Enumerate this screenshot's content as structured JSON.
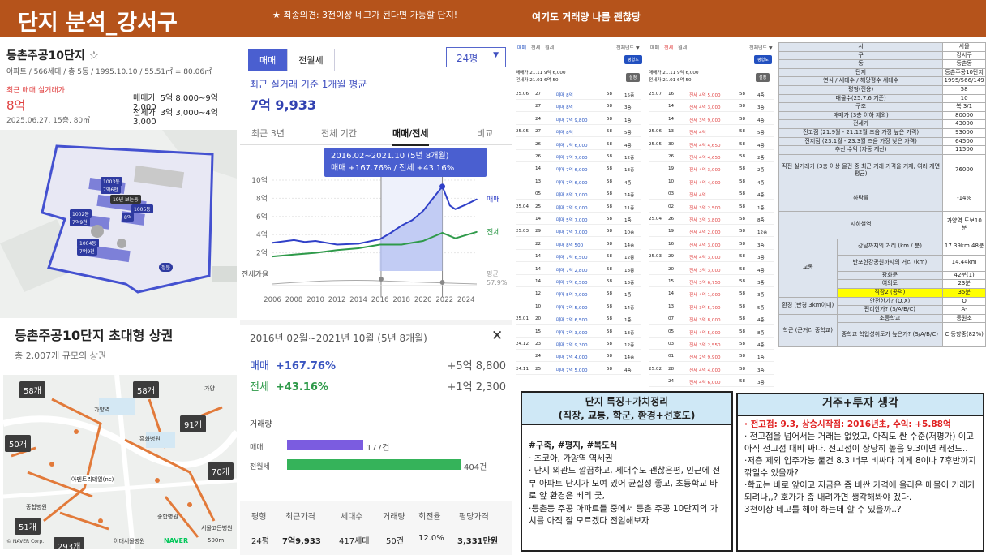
{
  "banner": {
    "title": "단지 분석_강서구",
    "opinion": "★ 최종의견: 3천이상 네고가 된다면 가능할 단지!",
    "note": "여기도 거래량 나름 괜찮당"
  },
  "listing": {
    "name": "등촌주공10단지 ☆",
    "meta": "아파트 / 566세대 / 총 5동 / 1995.10.10 / 55.51㎡ = 80.06㎡",
    "recent_label": "최근 매매 실거래가",
    "recent_price": "8억",
    "recent_date": "2025.06.27, 15층, 80㎡",
    "sale_label": "매매가",
    "sale_range": "5억 8,000~9억 2,000",
    "jeonse_label": "전세가",
    "jeonse_range": "3억 3,000~4억 3,000"
  },
  "map1": {
    "buildings": [
      "1003동",
      "1002동",
      "1001동",
      "1005동",
      "1006동",
      "1004동"
    ],
    "prices": [
      "7억6천",
      "7억9천",
      "8억",
      "7억9천"
    ],
    "other_label": "19년 보는동",
    "exit_label": "정문"
  },
  "commercial": {
    "title": "등촌주공10단지 초대형 상권",
    "subtitle": "총 2,007개 규모의 상권",
    "counts": [
      "58개",
      "58개",
      "91개",
      "50개",
      "70개",
      "51개",
      "293개"
    ],
    "places": [
      "아펜트리테일(nc)",
      "종합병원",
      "종합병원",
      "흥화병원",
      "서울고든병원",
      "가양역",
      "가양",
      "이대서울병원",
      "500m"
    ],
    "naver": "NAVER",
    "credit": "© NAVER Corp."
  },
  "price": {
    "tabs": [
      "매매",
      "전월세"
    ],
    "size": "24평",
    "avg_label": "최근 실거래 기준 1개월 평균",
    "avg_value": "7억 9,933",
    "period_tabs": [
      "최근 3년",
      "전체 기간",
      "매매/전세",
      "비교"
    ],
    "tooltip_title": "2016.02~2021.10 (5년 8개월)",
    "tooltip_body": "매매 +167.76%  /  전세 +43.16%",
    "legend_sale": "매매",
    "legend_jeonse": "전세",
    "legend_ratio1": "평균",
    "legend_ratio2": "57.9%",
    "ratio_label": "전세가율",
    "y_ticks": [
      "10억",
      "8억",
      "6억",
      "4억",
      "2억"
    ],
    "x_ticks": [
      "2006",
      "2008",
      "2010",
      "2012",
      "2014",
      "2016",
      "2018",
      "2020",
      "2022",
      "2024"
    ],
    "period": "2016년 02월~2021년 10월 (5년 8개월)",
    "close": "✕",
    "sale_label": "매매",
    "sale_pct": "+167.76%",
    "sale_amt": "+5억 8,800",
    "jeonse_label": "전세",
    "jeonse_pct": "+43.16%",
    "jeonse_amt": "+1억 2,300",
    "vol_title": "거래량",
    "vol_sale_label": "매매",
    "vol_sale": "177건",
    "vol_rent_label": "전월세",
    "vol_rent": "404건",
    "table_headers": [
      "평형",
      "최근가격",
      "세대수",
      "거래량",
      "회전율",
      "평당가격"
    ],
    "table_row": [
      "24평",
      "7억9,933",
      "417세대",
      "50건",
      "12.0%",
      "3,331만원"
    ]
  },
  "chart_data": {
    "type": "line",
    "x_range": [
      2006,
      2025
    ],
    "y_range_eok": [
      0,
      10
    ],
    "series": [
      {
        "name": "매매",
        "points": [
          [
            2006,
            3.1
          ],
          [
            2008,
            3.4
          ],
          [
            2009,
            3.2
          ],
          [
            2010,
            3.3
          ],
          [
            2012,
            2.9
          ],
          [
            2014,
            3.0
          ],
          [
            2016,
            3.5
          ],
          [
            2017,
            4.2
          ],
          [
            2018,
            5.0
          ],
          [
            2019,
            5.6
          ],
          [
            2020,
            6.6
          ],
          [
            2021,
            8.1
          ],
          [
            2021.8,
            9.3
          ],
          [
            2022.5,
            7.2
          ],
          [
            2023,
            6.8
          ],
          [
            2024,
            7.3
          ],
          [
            2025,
            7.9
          ]
        ]
      },
      {
        "name": "전세",
        "points": [
          [
            2006,
            1.6
          ],
          [
            2008,
            1.8
          ],
          [
            2010,
            2.0
          ],
          [
            2012,
            2.3
          ],
          [
            2014,
            2.5
          ],
          [
            2016,
            2.9
          ],
          [
            2018,
            2.9
          ],
          [
            2020,
            3.3
          ],
          [
            2021.8,
            4.2
          ],
          [
            2023,
            3.6
          ],
          [
            2025,
            4.3
          ]
        ]
      }
    ],
    "ratio_avg": "57.9%"
  },
  "trades": {
    "tabsA": [
      "매매",
      "전세",
      "월세"
    ],
    "tabsB": [
      "매매",
      "전세",
      "월세"
    ],
    "sel": "전체년도 ▼",
    "btn": "평형도",
    "btn2": "설정",
    "infoA": [
      "매매가 21.11 9억 6,000",
      "전세가 21.01 6억 50"
    ],
    "infoB": [
      "매매가 21.11 9억 6,000",
      "전세가 21.01 6억 50"
    ],
    "rowsA": [
      [
        "25.06",
        "27",
        "매매 8억",
        "58",
        "15층"
      ],
      [
        "",
        "27",
        "매매 8억",
        "58",
        "3층"
      ],
      [
        "",
        "24",
        "매매 7억 9,800",
        "58",
        "1층"
      ],
      [
        "25.05",
        "27",
        "매매 8억",
        "58",
        "5층"
      ],
      [
        "",
        "26",
        "매매 7억 6,000",
        "58",
        "4층"
      ],
      [
        "",
        "26",
        "매매 7억 7,000",
        "58",
        "12층"
      ],
      [
        "",
        "14",
        "매매 7억 6,000",
        "58",
        "13층"
      ],
      [
        "",
        "13",
        "매매 7억 6,000",
        "58",
        "4층"
      ],
      [
        "",
        "05",
        "매매 8억 1,000",
        "58",
        "14층"
      ],
      [
        "25.04",
        "25",
        "매매 7억 9,000",
        "58",
        "11층"
      ],
      [
        "",
        "14",
        "매매 5억 7,000",
        "58",
        "1층"
      ],
      [
        "25.03",
        "29",
        "매매 7억 7,000",
        "58",
        "10층"
      ],
      [
        "",
        "22",
        "매매 8억 500",
        "58",
        "14층"
      ],
      [
        "",
        "14",
        "매매 7억 6,500",
        "58",
        "12층"
      ],
      [
        "",
        "14",
        "매매 7억 2,800",
        "58",
        "13층"
      ],
      [
        "",
        "14",
        "매매 7억 6,500",
        "58",
        "13층"
      ],
      [
        "",
        "12",
        "매매 5억 7,000",
        "58",
        "1층"
      ],
      [
        "",
        "10",
        "매매 7억 5,000",
        "58",
        "14층"
      ],
      [
        "25.01",
        "20",
        "매매 7억 6,500",
        "58",
        "1층"
      ],
      [
        "",
        "15",
        "매매 7억 3,000",
        "58",
        "13층"
      ],
      [
        "24.12",
        "23",
        "매매 7억 9,300",
        "58",
        "12층"
      ],
      [
        "",
        "24",
        "매매 7억 4,000",
        "58",
        "14층"
      ],
      [
        "24.11",
        "25",
        "매매 7억 5,000",
        "58",
        "4층"
      ]
    ],
    "rowsB": [
      [
        "25.07",
        "16",
        "전세 4억 5,000",
        "58",
        "4층"
      ],
      [
        "",
        "14",
        "전세 4억 3,000",
        "58",
        "3층"
      ],
      [
        "",
        "14",
        "전세 3억 9,000",
        "58",
        "4층"
      ],
      [
        "25.06",
        "13",
        "전세 4억",
        "58",
        "5층"
      ],
      [
        "25.05",
        "30",
        "전세 4억 4,650",
        "58",
        "4층"
      ],
      [
        "",
        "26",
        "전세 4억 4,650",
        "58",
        "2층"
      ],
      [
        "",
        "19",
        "전세 4억 3,000",
        "58",
        "2층"
      ],
      [
        "",
        "10",
        "전세 4억 4,000",
        "58",
        "4층"
      ],
      [
        "",
        "03",
        "전세 4억",
        "58",
        "4층"
      ],
      [
        "",
        "02",
        "전세 3억 2,500",
        "58",
        "1층"
      ],
      [
        "25.04",
        "26",
        "전세 3억 3,800",
        "58",
        "8층"
      ],
      [
        "",
        "19",
        "전세 4억 2,000",
        "58",
        "12층"
      ],
      [
        "",
        "16",
        "전세 4억 3,000",
        "58",
        "3층"
      ],
      [
        "25.03",
        "29",
        "전세 4억 3,000",
        "58",
        "3층"
      ],
      [
        "",
        "20",
        "전세 3억 3,000",
        "58",
        "4층"
      ],
      [
        "",
        "15",
        "전세 3억 6,750",
        "58",
        "3층"
      ],
      [
        "",
        "14",
        "전세 4억 1,000",
        "58",
        "3층"
      ],
      [
        "",
        "13",
        "전세 3억 5,700",
        "58",
        "5층"
      ],
      [
        "",
        "07",
        "전세 3억 8,000",
        "58",
        "4층"
      ],
      [
        "",
        "05",
        "전세 4억 5,000",
        "58",
        "8층"
      ],
      [
        "",
        "03",
        "전세 3억 2,550",
        "58",
        "4층"
      ],
      [
        "",
        "01",
        "전세 2억 9,900",
        "58",
        "1층"
      ],
      [
        "25.02",
        "28",
        "전세 4억 4,000",
        "58",
        "3층"
      ],
      [
        "",
        "24",
        "전세 4억 6,000",
        "58",
        "3층"
      ],
      [
        "",
        "13",
        "전세 3억 6,200",
        "58",
        "4층"
      ]
    ]
  },
  "summary": {
    "rows": [
      [
        "시",
        "서울"
      ],
      [
        "구",
        "강서구"
      ],
      [
        "동",
        "등촌동"
      ],
      [
        "단지",
        "등촌주공10단지"
      ],
      [
        "연식 / 세대수 / 해당평수 세대수",
        "1995/566/149"
      ],
      [
        "평형(전용)",
        "58"
      ],
      [
        "매물수(25.7.6 기준)",
        "10"
      ],
      [
        "구조",
        "복 3/1"
      ],
      [
        "매매가 (3층 이하 제외)",
        "80000"
      ],
      [
        "전세가",
        "43000"
      ],
      [
        "전고점 (21.9월 - 21.12월 즈음 가장 높은 가격)",
        "93000"
      ],
      [
        "전저점 (23.1월 - 23.3월 즈음 가장 낮은 가격)",
        "64500"
      ],
      [
        "추산 수익 (자동 계산)",
        "11500"
      ],
      [
        "직전 실거래가 (3층 이상 물건 중 최근 거래 가격을 기재, 여러 개면 평균)",
        "76000"
      ],
      [
        "하락률",
        "-14%"
      ],
      [
        "지하철역",
        "가양역 도보10분"
      ]
    ],
    "traffic_label": "교통",
    "traffic": [
      [
        "강남까지의 거리 (km / 분)",
        "17.39km",
        "48분"
      ],
      [
        "반포한강공원까지의 거리 (km)",
        "",
        "14.44km"
      ],
      [
        "광화문",
        "",
        "42분(1)"
      ],
      [
        "여의도",
        "",
        "23분"
      ],
      [
        "직장2 (공덕)",
        "",
        "35분"
      ]
    ],
    "env_label": "환경 (반경 3km이내)",
    "env": [
      [
        "안전한가? (O,X)",
        "O"
      ],
      [
        "편리한가? (S/A/B/C)",
        "A-"
      ]
    ],
    "school_label": "학군 (근거리 중학교)",
    "school": [
      [
        "초등학교",
        "등원초"
      ],
      [
        "중학교 학업성취도가 높은가? (S/A/B/C)",
        "C 등향중(82%)"
      ]
    ]
  },
  "box1": {
    "title1": "단지 특징+가치정리",
    "title2": "(직장, 교통, 학군, 환경+선호도)",
    "tags": "#구축, #평지, #복도식",
    "lines": [
      "· 초코아, 가양역 역세권",
      "· 단지 외관도 깔끔하고, 세대수도 괜찮은편, 인근에 전부 아파트 단지가 모여 있어 균질성 좋고, 초등학교 바로 앞 환경은 베리 굿,",
      "·등촌동 주공 아파트들 중에서 등촌 주공 10단지의 가치를 아직 잘 모르겠다 전임해보자"
    ]
  },
  "box2": {
    "title": "거주+투자 생각",
    "highlight": "· 전고점: 9.3, 상승시작점: 2016년초, 수익: +5.88억",
    "lines": [
      "· 전고점을 넘어서는 거래는 없었고, 아직도 싼 수준(저평가) 이고 아직 전고점 대비 싸다. 전고점이 상당히 높음 9.3이면 레전드..",
      "·저층 제외 입주가능 물건 8.3 너무 비싸다 이게 8이나 7후반까지 깎일수 있을까?",
      "·학교는 바로 앞이고 지금은 좀 비싼 가격에 올라온 매물이 거래가 되려나,,? 호가가 좀 내려가면 생각해봐야 겠다.",
      "3천이상 네고를 해야 하는데 할 수 있을까..?"
    ]
  }
}
